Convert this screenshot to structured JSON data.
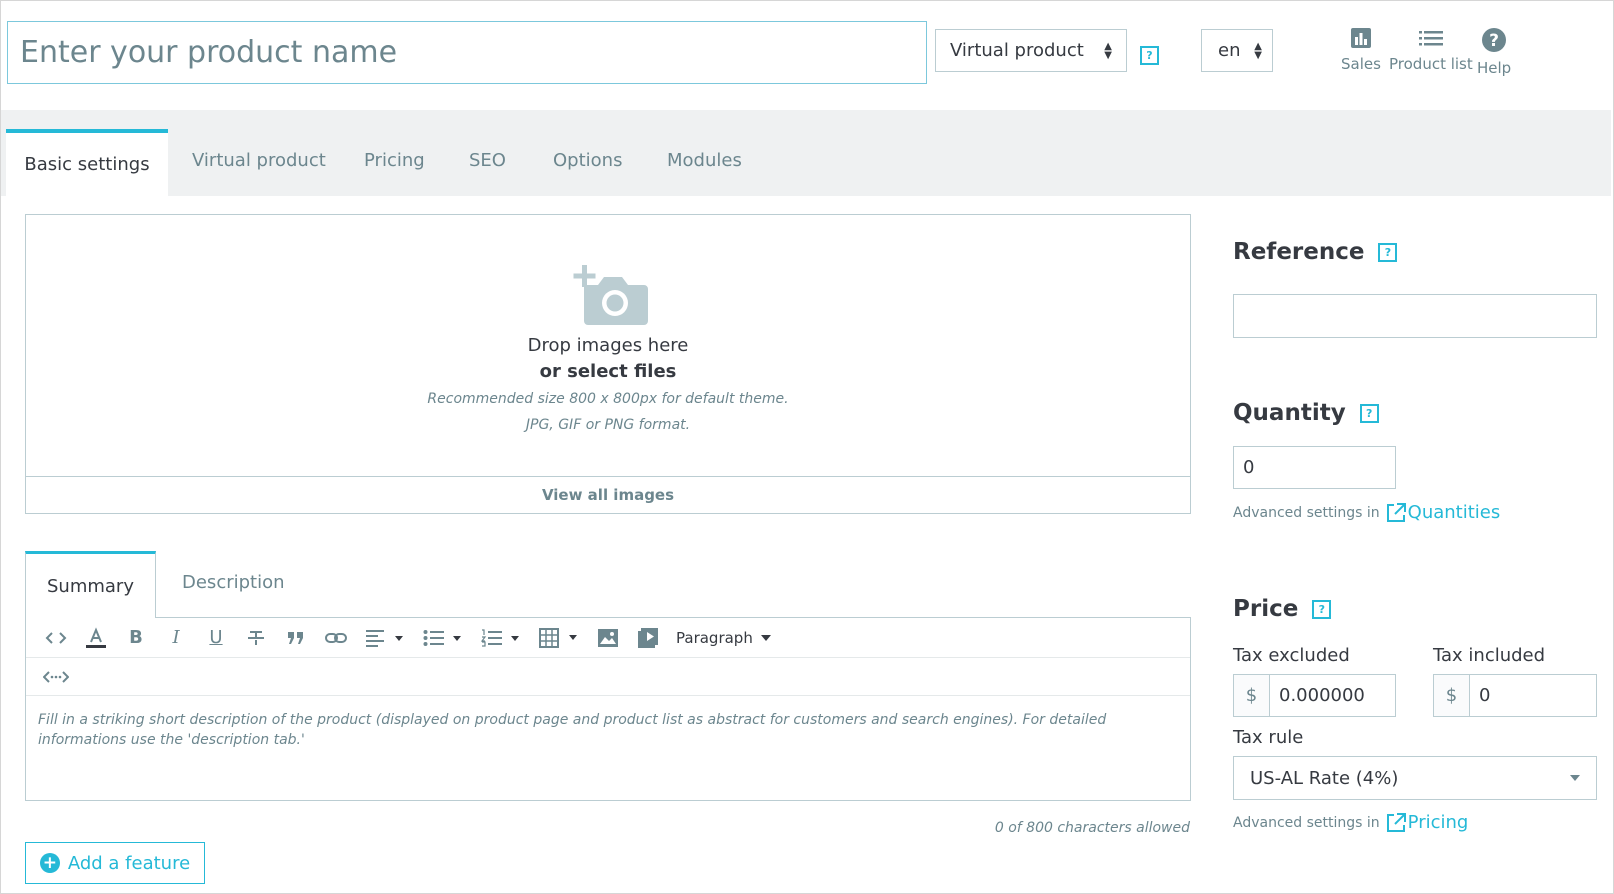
{
  "header": {
    "name_placeholder": "Enter your product name",
    "product_type": "Virtual product",
    "language": "en",
    "links": [
      {
        "label": "Sales",
        "icon": "bar-chart-icon"
      },
      {
        "label": "Product list",
        "icon": "list-icon"
      },
      {
        "label": "Help",
        "icon": "question-circle-icon"
      }
    ]
  },
  "tabs": [
    "Basic settings",
    "Virtual product",
    "Pricing",
    "SEO",
    "Options",
    "Modules"
  ],
  "images": {
    "drop_title": "Drop images here",
    "drop_sub": "or select files",
    "hint_size": "Recommended size 800 x 800px for default theme.",
    "hint_format": "JPG, GIF or PNG format.",
    "view_all": "View all images"
  },
  "summary": {
    "tabs": [
      "Summary",
      "Description"
    ],
    "paragraph": "Paragraph",
    "placeholder": "Fill in a striking short description of the product (displayed on product page and product list as abstract for customers and search engines). For detailed informations use the 'description tab.'",
    "counter": "0 of 800 characters allowed",
    "add_feature": "Add a feature"
  },
  "reference": {
    "label": "Reference",
    "value": ""
  },
  "quantity": {
    "label": "Quantity",
    "value": "0",
    "adv_text": "Advanced settings in",
    "adv_link": "Quantities"
  },
  "price": {
    "label": "Price",
    "tax_excluded_label": "Tax excluded",
    "tax_included_label": "Tax included",
    "currency": "$",
    "tax_excluded_value": "0.000000",
    "tax_included_value": "0",
    "tax_rule_label": "Tax rule",
    "tax_rule_value": "US-AL Rate (4%)",
    "adv_text": "Advanced settings in",
    "adv_link": "Pricing"
  },
  "help_glyph": "?",
  "colors": {
    "accent": "#25b9d7",
    "border": "#bbcdd2",
    "muted": "#6c868e",
    "text": "#363a41"
  }
}
